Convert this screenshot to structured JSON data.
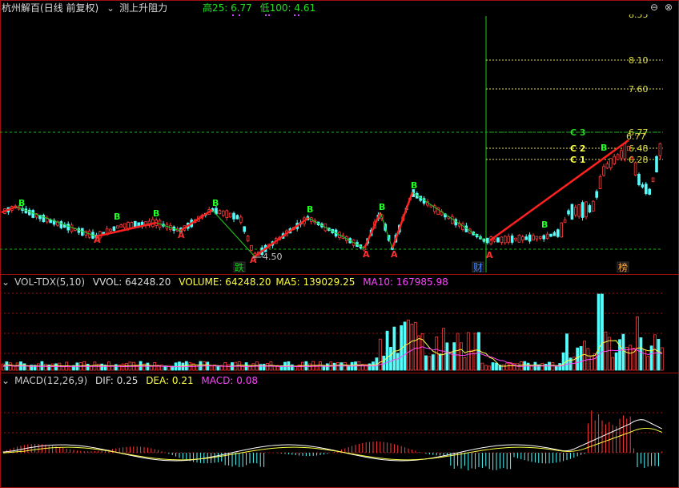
{
  "header": {
    "stock": "杭州解百",
    "period": "(日线 前复权)",
    "indicator": "测上升阻力",
    "high_label": "高25: 6.77",
    "low_label": "低100: 4.61"
  },
  "price_chart": {
    "low_marker": "4.50",
    "resistance_levels": [
      "8.10",
      "7.60",
      "6.77",
      "6.48",
      "6.28"
    ],
    "top_level": "8.55",
    "level_tags": [
      "C 3",
      "C 2",
      "C 1"
    ],
    "last_price": "6.77",
    "events": [
      "跌",
      "财",
      "榜"
    ],
    "signal_b": "B",
    "signal_a": "A"
  },
  "volume": {
    "name": "VOL-TDX(5,10)",
    "vvol": "VVOL: 64248.20",
    "volume": "VOLUME: 64248.20",
    "ma5": "MA5: 139029.25",
    "ma10": "MA10: 167985.98"
  },
  "macd": {
    "name": "MACD(12,26,9)",
    "dif": "DIF: 0.25",
    "dea": "DEA: 0.21",
    "macd": "MACD: 0.08"
  },
  "colors": {
    "up": "#ff3c3c",
    "down": "#54fcfc",
    "trend": "#ff2020",
    "grid": "#a01010",
    "green": "#22dd22",
    "yellow": "#ffff44",
    "magenta": "#ff44ff"
  },
  "icons": {
    "window": "dash-circle-icon",
    "close": "close-circle-icon",
    "dropdown": "chevron-down-icon"
  }
}
